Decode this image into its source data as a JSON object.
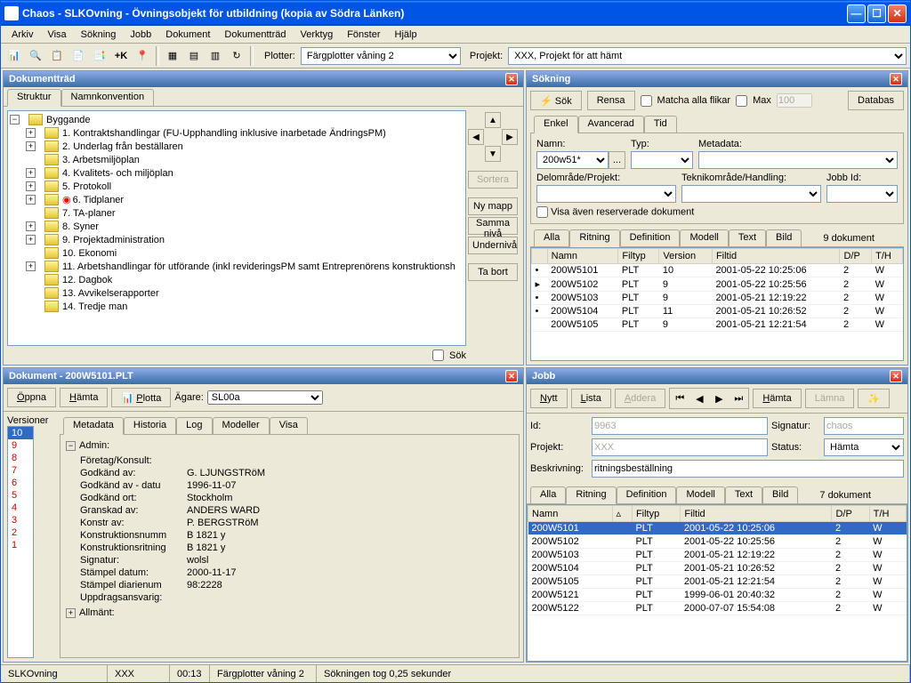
{
  "window": {
    "title": "Chaos - SLKOvning - Övningsobjekt för utbildning (kopia av Södra Länken)"
  },
  "menu": [
    "Arkiv",
    "Visa",
    "Sökning",
    "Jobb",
    "Dokument",
    "Dokumentträd",
    "Verktyg",
    "Fönster",
    "Hjälp"
  ],
  "toolbar": {
    "plotter_label": "Plotter:",
    "plotter_value": "Färgplotter våning 2",
    "projekt_label": "Projekt:",
    "projekt_value": "XXX, Projekt för att hämt"
  },
  "dokumenttrad": {
    "title": "Dokumentträd",
    "tabs": [
      "Struktur",
      "Namnkonvention"
    ],
    "root": "Byggande",
    "items": [
      {
        "exp": "+",
        "label": "1. Kontraktshandlingar (FU-Upphandling inklusive inarbetade ÄndringsPM)"
      },
      {
        "exp": "+",
        "label": "2. Underlag från beställaren"
      },
      {
        "exp": "",
        "label": "3. Arbetsmiljöplan"
      },
      {
        "exp": "+",
        "label": "4. Kvalitets- och miljöplan"
      },
      {
        "exp": "+",
        "label": "5. Protokoll"
      },
      {
        "exp": "+",
        "label": "6. Tidplaner",
        "flag": true
      },
      {
        "exp": "",
        "label": "7. TA-planer"
      },
      {
        "exp": "+",
        "label": "8. Syner"
      },
      {
        "exp": "+",
        "label": "9. Projektadministration"
      },
      {
        "exp": "",
        "label": "10. Ekonomi"
      },
      {
        "exp": "+",
        "label": "11. Arbetshandlingar för utförande (inkl revideringsPM samt Entreprenörens konstruktionsh"
      },
      {
        "exp": "",
        "label": "12. Dagbok"
      },
      {
        "exp": "",
        "label": "13. Avvikelserapporter"
      },
      {
        "exp": "",
        "label": "14. Tredje man"
      }
    ],
    "side": {
      "sortera": "Sortera",
      "nymapp": "Ny mapp",
      "samma": "Samma nivå",
      "under": "Undernivå",
      "tabort": "Ta bort",
      "sok": "Sök"
    }
  },
  "sokning": {
    "title": "Sökning",
    "sok": "Sök",
    "rensa": "Rensa",
    "matcha": "Matcha alla flikar",
    "max": "Max",
    "max_value": "100",
    "databas": "Databas",
    "tabs": [
      "Enkel",
      "Avancerad",
      "Tid"
    ],
    "form": {
      "namn": "Namn:",
      "namn_value": "200w51*",
      "typ": "Typ:",
      "metadata": "Metadata:",
      "del": "Delområde/Projekt:",
      "teknik": "Teknikområde/Handling:",
      "jobbid": "Jobb Id:",
      "visa": "Visa även reserverade dokument"
    },
    "rtabs": [
      "Alla",
      "Ritning",
      "Definition",
      "Modell",
      "Text",
      "Bild"
    ],
    "rcount": "9 dokument",
    "cols": [
      "",
      "Namn",
      "Filtyp",
      "Version",
      "Filtid",
      "D/P",
      "T/H"
    ],
    "rows": [
      [
        "•",
        "200W5101",
        "PLT",
        "10",
        "2001-05-22 10:25:06",
        "2",
        "W"
      ],
      [
        "▸",
        "200W5102",
        "PLT",
        "9",
        "2001-05-22 10:25:56",
        "2",
        "W"
      ],
      [
        "•",
        "200W5103",
        "PLT",
        "9",
        "2001-05-21 12:19:22",
        "2",
        "W"
      ],
      [
        "•",
        "200W5104",
        "PLT",
        "11",
        "2001-05-21 10:26:52",
        "2",
        "W"
      ],
      [
        "",
        "200W5105",
        "PLT",
        "9",
        "2001-05-21 12:21:54",
        "2",
        "W"
      ]
    ]
  },
  "dokument": {
    "title": "Dokument - 200W5101.PLT",
    "oppna": "Öppna",
    "hamta": "Hämta",
    "plotta": "Plotta",
    "agare": "Ägare:",
    "agare_value": "SL00a",
    "vlabel": "Versioner",
    "versions": [
      "10",
      "9",
      "8",
      "7",
      "6",
      "5",
      "4",
      "3",
      "2",
      "1"
    ],
    "tabs": [
      "Metadata",
      "Historia",
      "Log",
      "Modeller",
      "Visa"
    ],
    "group": "Admin:",
    "meta": [
      [
        "Företag/Konsult:",
        ""
      ],
      [
        "Godkänd av:",
        "G. LJUNGSTRöM"
      ],
      [
        "Godkänd av - datu",
        "1996-11-07"
      ],
      [
        "Godkänd ort:",
        "Stockholm"
      ],
      [
        "Granskad av:",
        "ANDERS WARD"
      ],
      [
        "Konstr av:",
        "P. BERGSTRöM"
      ],
      [
        "Konstruktionsnumm",
        "B 1821 y"
      ],
      [
        "Konstruktionsritning",
        "B 1821 y"
      ],
      [
        "Signatur:",
        "wolsl"
      ],
      [
        "Stämpel datum:",
        "2000-11-17"
      ],
      [
        "Stämpel diarienum",
        "98:2228"
      ],
      [
        "Uppdragsansvarig:",
        ""
      ]
    ],
    "group2": "Allmänt:"
  },
  "jobb": {
    "title": "Jobb",
    "nytt": "Nytt",
    "lista": "Lista",
    "addera": "Addera",
    "hamta": "Hämta",
    "lamna": "Lämna",
    "id": "Id:",
    "id_value": "9963",
    "signatur": "Signatur:",
    "signatur_value": "chaos",
    "projekt": "Projekt:",
    "projekt_value": "XXX",
    "status": "Status:",
    "status_value": "Hämta",
    "beskrivning": "Beskrivning:",
    "beskrivning_value": "ritningsbeställning",
    "rtabs": [
      "Alla",
      "Ritning",
      "Definition",
      "Modell",
      "Text",
      "Bild"
    ],
    "rcount": "7 dokument",
    "cols": [
      "Namn",
      "▵",
      "Filtyp",
      "Filtid",
      "D/P",
      "T/H"
    ],
    "rows": [
      [
        "200W5101",
        "",
        "PLT",
        "2001-05-22 10:25:06",
        "2",
        "W",
        true
      ],
      [
        "200W5102",
        "",
        "PLT",
        "2001-05-22 10:25:56",
        "2",
        "W",
        false
      ],
      [
        "200W5103",
        "",
        "PLT",
        "2001-05-21 12:19:22",
        "2",
        "W",
        false
      ],
      [
        "200W5104",
        "",
        "PLT",
        "2001-05-21 10:26:52",
        "2",
        "W",
        false
      ],
      [
        "200W5105",
        "",
        "PLT",
        "2001-05-21 12:21:54",
        "2",
        "W",
        false
      ],
      [
        "200W5121",
        "",
        "PLT",
        "1999-06-01 20:40:32",
        "2",
        "W",
        false
      ],
      [
        "200W5122",
        "",
        "PLT",
        "2000-07-07 15:54:08",
        "2",
        "W",
        false
      ]
    ]
  },
  "status": {
    "s1": "SLKOvning",
    "s2": "XXX",
    "s3": "00:13",
    "s4": "Färgplotter våning 2",
    "s5": "Sökningen tog 0,25 sekunder"
  }
}
